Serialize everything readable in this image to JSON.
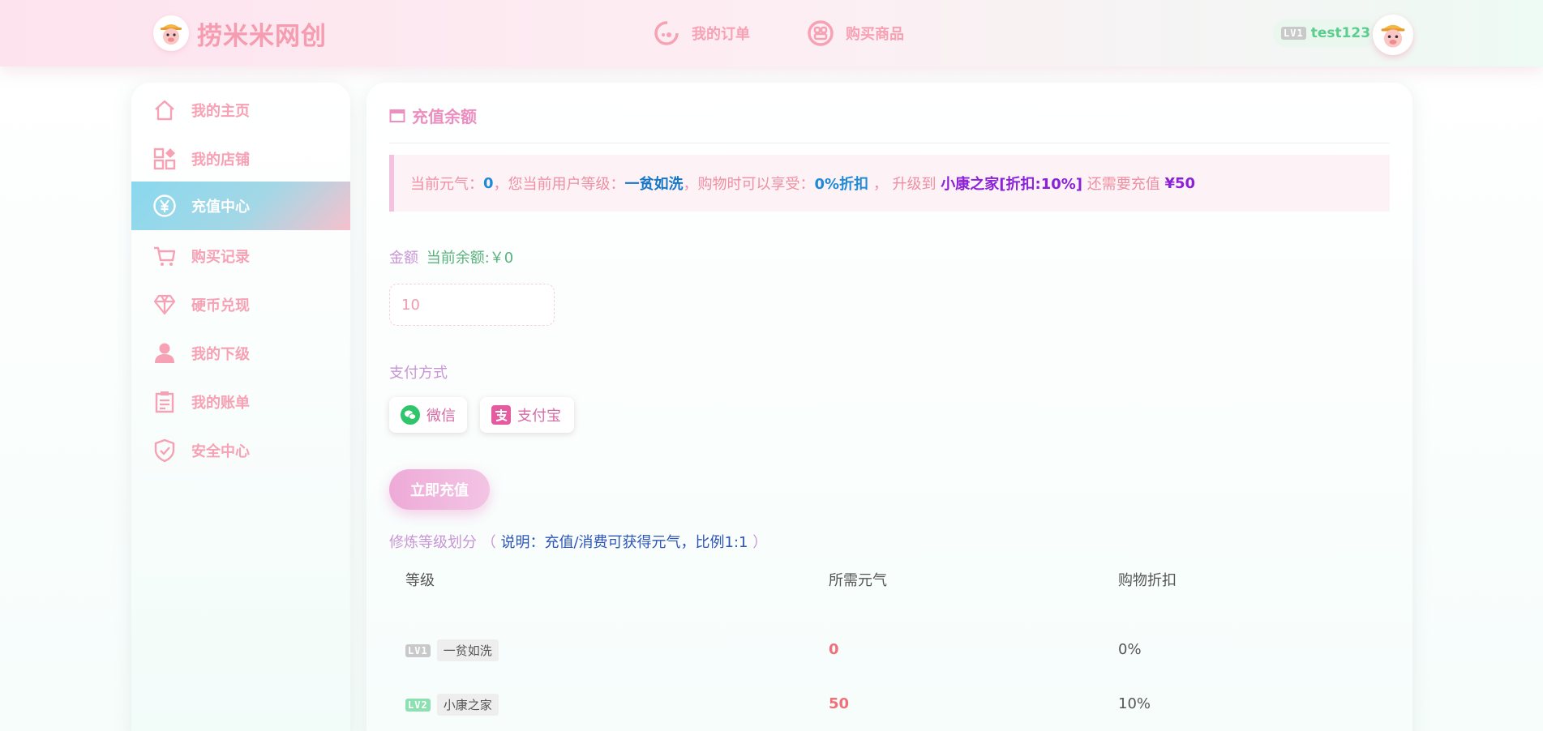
{
  "header": {
    "brand": "捞米米网创",
    "nav": [
      {
        "label": "我的订单",
        "icon": "orders-icon"
      },
      {
        "label": "购买商品",
        "icon": "buy-icon"
      }
    ],
    "user": {
      "level_badge": "LV1",
      "name": "test123"
    }
  },
  "sidebar": {
    "items": [
      {
        "label": "我的主页",
        "icon": "home-icon"
      },
      {
        "label": "我的店铺",
        "icon": "shop-icon"
      },
      {
        "label": "充值中心",
        "icon": "yen-icon",
        "active": true
      },
      {
        "label": "购买记录",
        "icon": "cart-icon"
      },
      {
        "label": "硬币兑现",
        "icon": "diamond-icon"
      },
      {
        "label": "我的下级",
        "icon": "user-icon"
      },
      {
        "label": "我的账单",
        "icon": "clipboard-icon"
      },
      {
        "label": "安全中心",
        "icon": "shield-icon"
      }
    ]
  },
  "main": {
    "title": "充值余额",
    "notice": {
      "p1": "当前元气：",
      "qi": "0",
      "p2": "，您当前用户等级：",
      "level": "一贫如洗",
      "p3": "，购物时可以享受：",
      "discount": "0%折扣",
      "p4": " ， 升级到 ",
      "next_level": "小康之家[折扣:10%]",
      "p5": " 还需要充值 ",
      "need": "¥50"
    },
    "amount_label": "金额",
    "balance_text": "当前余额:￥0",
    "amount_value": "10",
    "pay_label": "支付方式",
    "pay_methods": [
      {
        "label": "微信",
        "icon": "wechat-icon"
      },
      {
        "label": "支付宝",
        "icon": "alipay-icon"
      }
    ],
    "submit_label": "立即充值",
    "levels_title": "修炼等级划分",
    "levels_paren_open": "（",
    "levels_note": "说明：充值/消费可获得元气，比例1:1",
    "levels_paren_close": "）",
    "table": {
      "headers": [
        "等级",
        "所需元气",
        "购物折扣"
      ],
      "rows": [
        {
          "badge": "LV1",
          "name": "一贫如洗",
          "need": "0",
          "discount": "0%"
        },
        {
          "badge": "LV2",
          "name": "小康之家",
          "need": "50",
          "discount": "10%"
        }
      ]
    }
  },
  "colors": {
    "accent_pink": "#f7a1b4",
    "active_gradient_start": "#8ad8ee",
    "title_pink": "#ec8fc0"
  }
}
